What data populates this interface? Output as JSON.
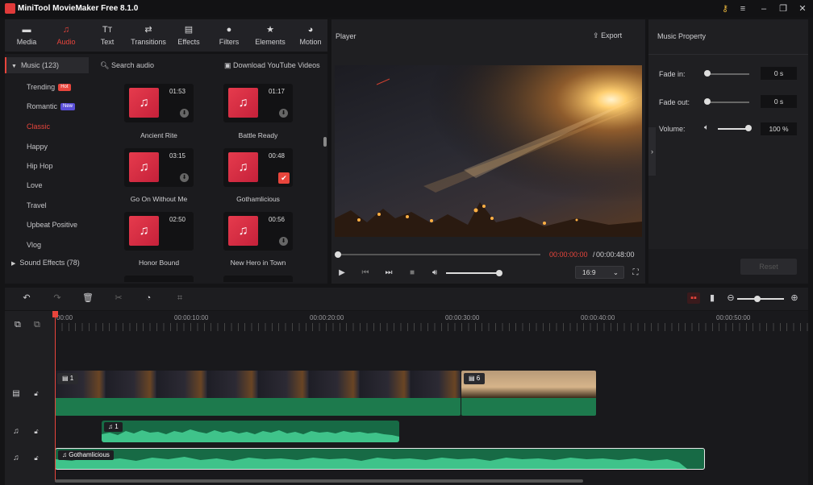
{
  "app": {
    "title": "MiniTool MovieMaker Free 8.1.0"
  },
  "window": {
    "key_icon": "key-icon",
    "menu_icon": "menu-icon",
    "min_icon": "minimize-icon",
    "max_icon": "maximize-icon",
    "close_icon": "close-icon"
  },
  "toolbar": {
    "tabs": [
      {
        "label": "Media",
        "icon": "folder-icon"
      },
      {
        "label": "Audio",
        "icon": "music-note-icon",
        "active": true
      },
      {
        "label": "Text",
        "icon": "text-icon"
      },
      {
        "label": "Transitions",
        "icon": "transitions-icon"
      },
      {
        "label": "Effects",
        "icon": "effects-icon"
      },
      {
        "label": "Filters",
        "icon": "filters-icon"
      },
      {
        "label": "Elements",
        "icon": "elements-icon"
      },
      {
        "label": "Motion",
        "icon": "motion-icon"
      }
    ]
  },
  "library": {
    "music_header": "Music (123)",
    "categories": [
      {
        "label": "Trending",
        "badge": "Hot"
      },
      {
        "label": "Romantic",
        "badge": "New"
      },
      {
        "label": "Classic",
        "active": true
      },
      {
        "label": "Happy"
      },
      {
        "label": "Hip Hop"
      },
      {
        "label": "Love"
      },
      {
        "label": "Travel"
      },
      {
        "label": "Upbeat Positive"
      },
      {
        "label": "Vlog"
      }
    ],
    "sound_effects": "Sound Effects (78)",
    "search_placeholder": "Search audio",
    "download_link": "Download YouTube Videos",
    "tracks": [
      {
        "title": "Ancient Rite",
        "duration": "01:53",
        "state": "download"
      },
      {
        "title": "Battle Ready",
        "duration": "01:17",
        "state": "download"
      },
      {
        "title": "Go On Without Me",
        "duration": "03:15",
        "state": "download"
      },
      {
        "title": "Gothamlicious",
        "duration": "00:48",
        "state": "added"
      },
      {
        "title": "Honor Bound",
        "duration": "02:50",
        "state": "download"
      },
      {
        "title": "New Hero in Town",
        "duration": "00:56",
        "state": "download"
      }
    ]
  },
  "player": {
    "title": "Player",
    "export_label": "Export",
    "current_time": "00:00:00:00",
    "separator": "/",
    "total_time": "00:00:48:00",
    "aspect_ratio": "16:9",
    "progress": 0,
    "volume": 1.0
  },
  "property": {
    "title": "Music Property",
    "fade_in_label": "Fade in:",
    "fade_in_value": "0 s",
    "fade_out_label": "Fade out:",
    "fade_out_value": "0 s",
    "volume_label": "Volume:",
    "volume_value": "100 %",
    "reset_label": "Reset"
  },
  "timeline": {
    "ruler": [
      "00:00",
      "00:00:10:00",
      "00:00:20:00",
      "00:00:30:00",
      "00:00:40:00",
      "00:00:50:00"
    ],
    "video_clips": [
      {
        "tag": "1"
      },
      {
        "tag": "6"
      }
    ],
    "audio_clips": [
      {
        "tag": "1"
      },
      {
        "tag": "Gothamlicious"
      }
    ]
  },
  "colors": {
    "accent": "#e8453c",
    "clip_green": "#1d7a4d",
    "audio_green": "#3fc38a"
  }
}
